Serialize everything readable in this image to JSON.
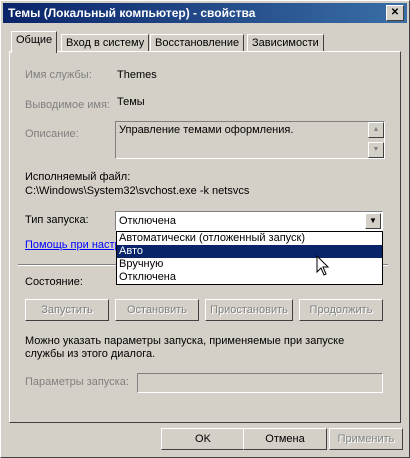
{
  "window": {
    "title": "Темы (Локальный компьютер) - свойства",
    "close_symbol": "✕"
  },
  "tabs": [
    {
      "label": "Общие"
    },
    {
      "label": "Вход в систему"
    },
    {
      "label": "Восстановление"
    },
    {
      "label": "Зависимости"
    }
  ],
  "general": {
    "service_name_label": "Имя службы:",
    "service_name_value": "Themes",
    "display_name_label": "Выводимое имя:",
    "display_name_value": "Темы",
    "description_label": "Описание:",
    "description_value": "Управление темами оформления.",
    "exe_label": "Исполняемый файл:",
    "exe_value": "C:\\Windows\\System32\\svchost.exe -k netsvcs",
    "startup_type_label": "Тип запуска:",
    "startup_type_value": "Отключена",
    "help_link": "Помощь при настройке параметров запуска служб.",
    "startup_options": [
      "Автоматически (отложенный запуск)",
      "Авто",
      "Вручную",
      "Отключена"
    ],
    "status_label": "Состояние:",
    "btn_start": "Запустить",
    "btn_stop": "Остановить",
    "btn_pause": "Приостановить",
    "btn_resume": "Продолжить",
    "hint": "Можно указать параметры запуска, применяемые при запуске службы из этого диалога.",
    "params_label": "Параметры запуска:",
    "params_value": ""
  },
  "footer": {
    "ok": "OK",
    "cancel": "Отмена",
    "apply": "Применить"
  },
  "colors": {
    "title_bar": "#0a246a",
    "selection": "#0a246a",
    "link": "#0000ff",
    "face": "#d4d0c8"
  }
}
